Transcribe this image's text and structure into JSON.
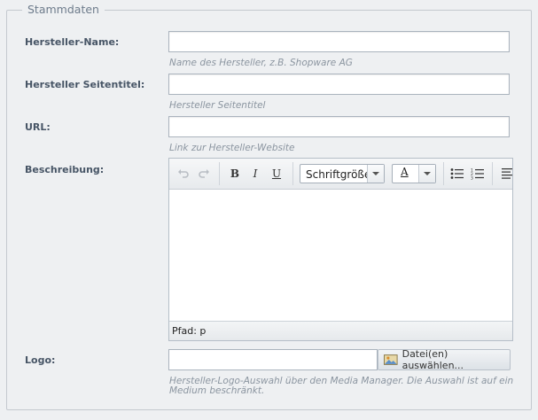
{
  "fieldset": {
    "legend": "Stammdaten"
  },
  "fields": {
    "name": {
      "label": "Hersteller-Name:",
      "value": "",
      "hint": "Name des Hersteller, z.B. Shopware AG"
    },
    "page_title": {
      "label": "Hersteller Seitentitel:",
      "value": "",
      "hint": "Hersteller Seitentitel"
    },
    "url": {
      "label": "URL:",
      "value": "",
      "hint": "Link zur Hersteller-Website"
    },
    "description": {
      "label": "Beschreibung:",
      "toolbar": {
        "undo_icon": "undo-icon",
        "redo_icon": "redo-icon",
        "bold": "B",
        "italic": "I",
        "underline": "U",
        "font_size": "Schriftgröße",
        "font_color_glyph": "A",
        "font_color_accent": "#000000"
      },
      "status_path": "Pfad: p"
    },
    "logo": {
      "label": "Logo:",
      "value": "",
      "button_label": "Datei(en) auswählen...",
      "hint_line1": "Hersteller-Logo-Auswahl über den Media Manager. Die Auswahl ist auf ein",
      "hint_line2": "Medium beschränkt."
    }
  }
}
